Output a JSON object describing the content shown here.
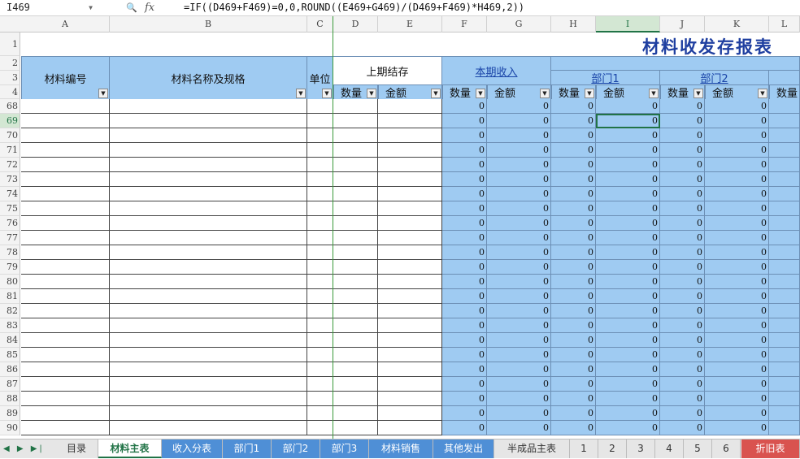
{
  "formula_bar": {
    "name_box": "I469",
    "fx_label": "fx",
    "formula": "=IF((D469+F469)=0,0,ROUND((E469+G469)/(D469+F469)*H469,2))"
  },
  "columns": [
    "A",
    "B",
    "C",
    "D",
    "E",
    "F",
    "G",
    "H",
    "I",
    "J",
    "K",
    "L"
  ],
  "selected_column": "I",
  "header_rows": [
    "1",
    "2",
    "3",
    "4"
  ],
  "title": "材料收发存报表",
  "headers": {
    "material_code": "材料编号",
    "material_name": "材料名称及规格",
    "unit": "单位",
    "previous_balance": "上期结存",
    "current_income": "本期收入",
    "dept1": "部门1",
    "dept2": "部门2",
    "qty": "数量",
    "amount": "金额",
    "qty_partial": "数量"
  },
  "data_rows": [
    "68",
    "69",
    "70",
    "71",
    "72",
    "73",
    "74",
    "75",
    "76",
    "77",
    "78",
    "79",
    "80",
    "81",
    "82",
    "83",
    "84",
    "85",
    "86",
    "87",
    "88",
    "89",
    "90"
  ],
  "selected_row": "69",
  "cell_value": "0",
  "sheet_tabs": [
    {
      "label": "目录",
      "style": "normal"
    },
    {
      "label": "材料主表",
      "style": "active"
    },
    {
      "label": "收入分表",
      "style": "blue"
    },
    {
      "label": "部门1",
      "style": "blue"
    },
    {
      "label": "部门2",
      "style": "blue"
    },
    {
      "label": "部门3",
      "style": "blue"
    },
    {
      "label": "材料销售",
      "style": "blue"
    },
    {
      "label": "其他发出",
      "style": "blue"
    },
    {
      "label": "半成品主表",
      "style": "normal"
    },
    {
      "label": "1",
      "style": "normal"
    },
    {
      "label": "2",
      "style": "normal"
    },
    {
      "label": "3",
      "style": "normal"
    },
    {
      "label": "4",
      "style": "normal"
    },
    {
      "label": "5",
      "style": "normal"
    },
    {
      "label": "6",
      "style": "normal"
    },
    {
      "label": "折旧表",
      "style": "red"
    }
  ],
  "colors": {
    "header_blue": "#9fcbf2",
    "link": "#1a45a8",
    "select_green": "#217346",
    "tab_red": "#d9534f",
    "tab_blue": "#4f8fd6"
  }
}
